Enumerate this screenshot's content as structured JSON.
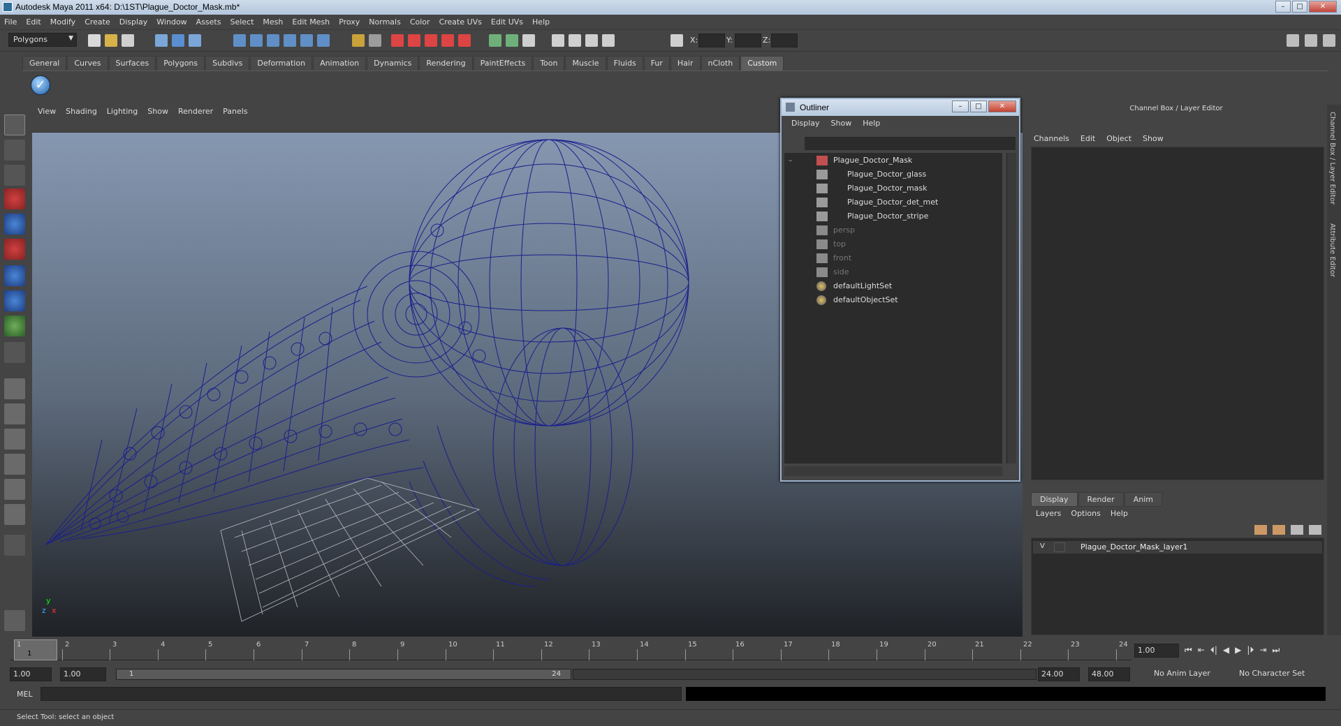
{
  "window": {
    "title": "Autodesk Maya 2011 x64: D:\\1ST\\Plague_Doctor_Mask.mb*",
    "minimize": "–",
    "maximize": "□",
    "close": "✕"
  },
  "menubar": [
    "File",
    "Edit",
    "Modify",
    "Create",
    "Display",
    "Window",
    "Assets",
    "Select",
    "Mesh",
    "Edit Mesh",
    "Proxy",
    "Normals",
    "Color",
    "Create UVs",
    "Edit UVs",
    "Help"
  ],
  "statusline": {
    "mode": "Polygons",
    "x_label": "X:",
    "y_label": "Y:",
    "z_label": "Z:"
  },
  "shelf": {
    "tabs": [
      "General",
      "Curves",
      "Surfaces",
      "Polygons",
      "Subdivs",
      "Deformation",
      "Animation",
      "Dynamics",
      "Rendering",
      "PaintEffects",
      "Toon",
      "Muscle",
      "Fluids",
      "Fur",
      "Hair",
      "nCloth",
      "Custom"
    ],
    "active_tab": "Custom"
  },
  "viewport": {
    "menu": [
      "View",
      "Shading",
      "Lighting",
      "Show",
      "Renderer",
      "Panels"
    ],
    "axis": {
      "x": "x",
      "y": "y",
      "z": "z"
    }
  },
  "outliner": {
    "title": "Outliner",
    "menu": [
      "Display",
      "Show",
      "Help"
    ],
    "items": [
      {
        "label": "Plague_Doctor_Mask",
        "indent": 0,
        "dim": false,
        "type": "group",
        "expander": "–"
      },
      {
        "label": "Plague_Doctor_glass",
        "indent": 1,
        "dim": false,
        "type": "mesh"
      },
      {
        "label": "Plague_Doctor_mask",
        "indent": 1,
        "dim": false,
        "type": "mesh"
      },
      {
        "label": "Plague_Doctor_det_met",
        "indent": 1,
        "dim": false,
        "type": "mesh"
      },
      {
        "label": "Plague_Doctor_stripe",
        "indent": 1,
        "dim": false,
        "type": "mesh"
      },
      {
        "label": "persp",
        "indent": 0,
        "dim": true,
        "type": "camera"
      },
      {
        "label": "top",
        "indent": 0,
        "dim": true,
        "type": "camera"
      },
      {
        "label": "front",
        "indent": 0,
        "dim": true,
        "type": "camera"
      },
      {
        "label": "side",
        "indent": 0,
        "dim": true,
        "type": "camera"
      },
      {
        "label": "defaultLightSet",
        "indent": 0,
        "dim": false,
        "type": "set"
      },
      {
        "label": "defaultObjectSet",
        "indent": 0,
        "dim": false,
        "type": "set"
      }
    ]
  },
  "channelbox": {
    "title": "Channel Box / Layer Editor",
    "menu": [
      "Channels",
      "Edit",
      "Object",
      "Show"
    ],
    "side_tabs": [
      "Channel Box / Layer Editor",
      "Attribute Editor"
    ]
  },
  "layers": {
    "tabs": [
      "Display",
      "Render",
      "Anim"
    ],
    "active_tab": "Display",
    "menu": [
      "Layers",
      "Options",
      "Help"
    ],
    "items": [
      {
        "visible": "V",
        "name": "Plague_Doctor_Mask_layer1"
      }
    ]
  },
  "timeline": {
    "ticks": [
      "1",
      "2",
      "3",
      "4",
      "5",
      "6",
      "7",
      "8",
      "9",
      "10",
      "11",
      "12",
      "13",
      "14",
      "15",
      "16",
      "17",
      "18",
      "19",
      "20",
      "21",
      "22",
      "23",
      "24"
    ],
    "cursor": "1",
    "current_frame": "1.00",
    "playback_icons": [
      "⏮",
      "⇤",
      "⏴|",
      "◀",
      "▶",
      "|⏵",
      "⇥",
      "⏭"
    ]
  },
  "range": {
    "start": "1.00",
    "start_inner": "1.00",
    "slider_left": "1",
    "slider_right": "24",
    "end_inner": "24.00",
    "end": "48.00",
    "anim_layer": "No Anim Layer",
    "character_set": "No Character Set"
  },
  "cmdline": {
    "label": "MEL"
  },
  "helpline": {
    "text": "Select Tool: select an object"
  },
  "colors": {
    "wireframe": "#1a1f8c",
    "accent": "#9bb3cf"
  }
}
